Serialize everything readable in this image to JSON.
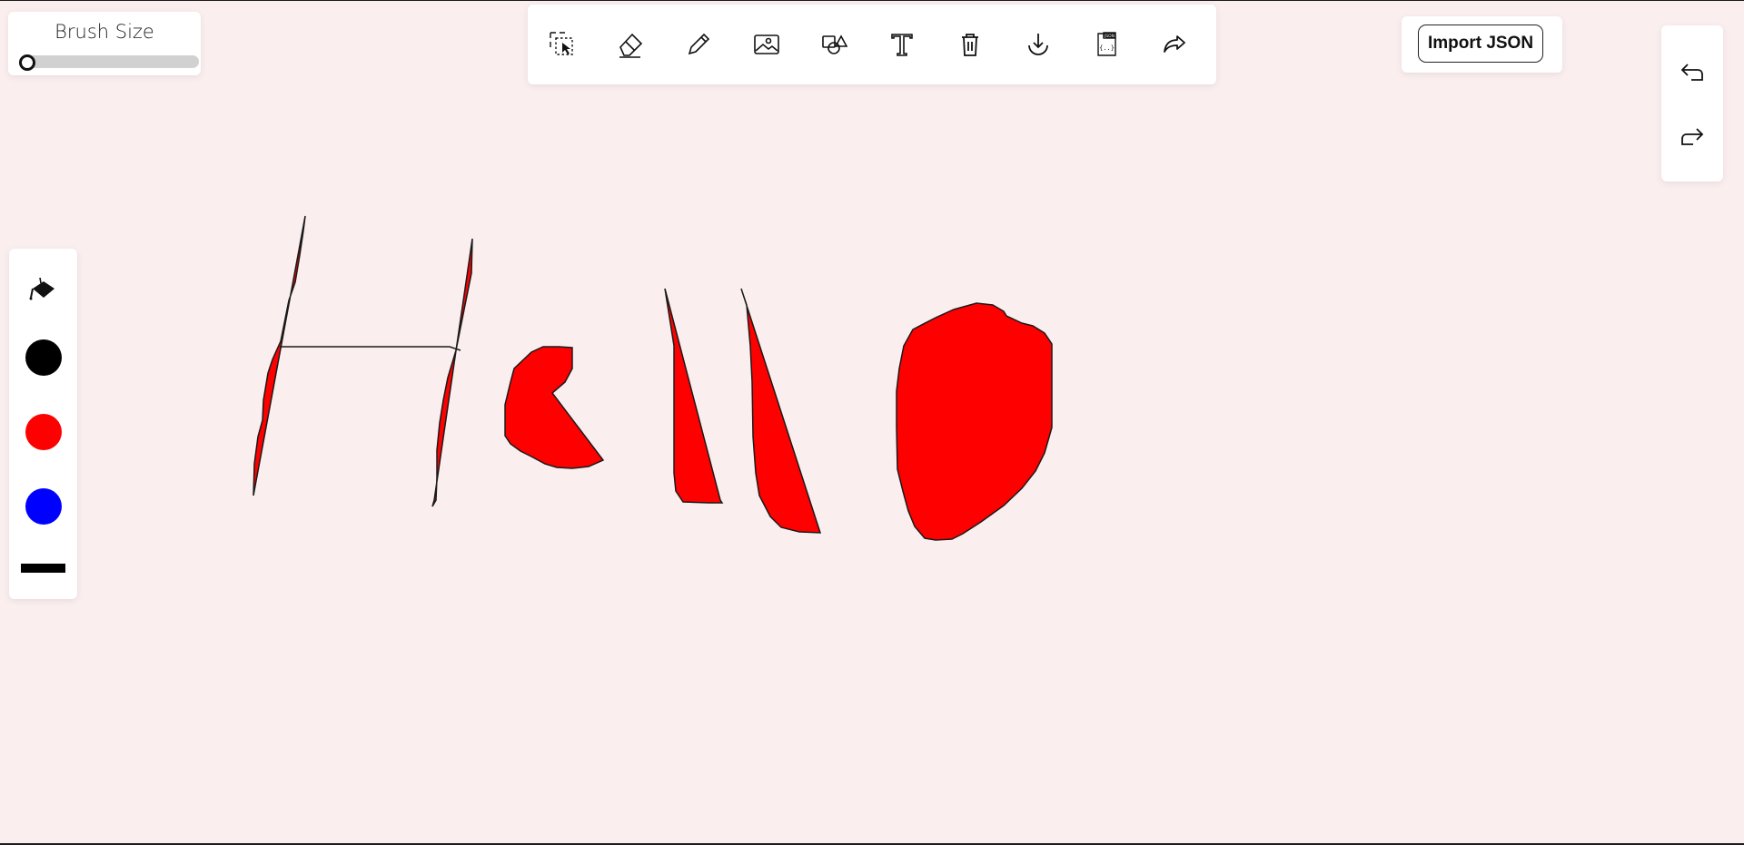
{
  "brush": {
    "title": "Brush Size",
    "value_fraction": 0.0
  },
  "toolbar": {
    "tools": [
      {
        "name": "select-tool",
        "icon": "selection-icon"
      },
      {
        "name": "eraser-tool",
        "icon": "eraser-icon"
      },
      {
        "name": "pencil-tool",
        "icon": "pencil-icon"
      },
      {
        "name": "image-tool",
        "icon": "image-icon"
      },
      {
        "name": "shapes-tool",
        "icon": "shapes-icon"
      },
      {
        "name": "text-tool",
        "icon": "text-icon"
      },
      {
        "name": "delete-tool",
        "icon": "trash-icon"
      },
      {
        "name": "download-tool",
        "icon": "download-icon"
      },
      {
        "name": "export-json-tool",
        "icon": "json-file-icon"
      },
      {
        "name": "share-tool",
        "icon": "share-icon"
      }
    ]
  },
  "import": {
    "label": "Import JSON"
  },
  "history": {
    "undo_icon": "undo-icon",
    "redo_icon": "redo-icon"
  },
  "palette": {
    "fill_icon": "paint-bucket-icon",
    "colors": [
      {
        "name": "black",
        "hex": "#000000"
      },
      {
        "name": "red",
        "hex": "#ff0000"
      },
      {
        "name": "blue",
        "hex": "#0000ff"
      }
    ],
    "stroke_color": "#000000"
  },
  "canvas": {
    "background": "#fbeeee",
    "fill_color": "#ff0000",
    "stroke_color": "#1a1a1a"
  }
}
